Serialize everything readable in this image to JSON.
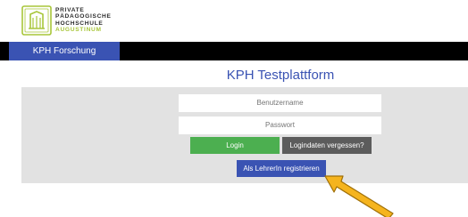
{
  "brand": {
    "line1": "PRIVATE",
    "line2": "PÄDAGOGISCHE",
    "line3": "HOCHSCHULE",
    "line4": "AUGUSTINUM",
    "accent_color": "#a8c63a"
  },
  "nav": {
    "tab_label": "KPH Forschung"
  },
  "page": {
    "title": "KPH Testplattform"
  },
  "login_form": {
    "username_placeholder": "Benutzername",
    "password_placeholder": "Passwort",
    "login_label": "Login",
    "forgot_label": "Logindaten vergessen?",
    "register_label": "Als LehrerIn registrieren"
  },
  "colors": {
    "primary_blue": "#3a53b3",
    "login_green": "#4caf50",
    "forgot_gray": "#5c5c5c",
    "arrow_yellow": "#f5b41e"
  },
  "annotation": {
    "icon": "pointer-arrow-icon"
  }
}
